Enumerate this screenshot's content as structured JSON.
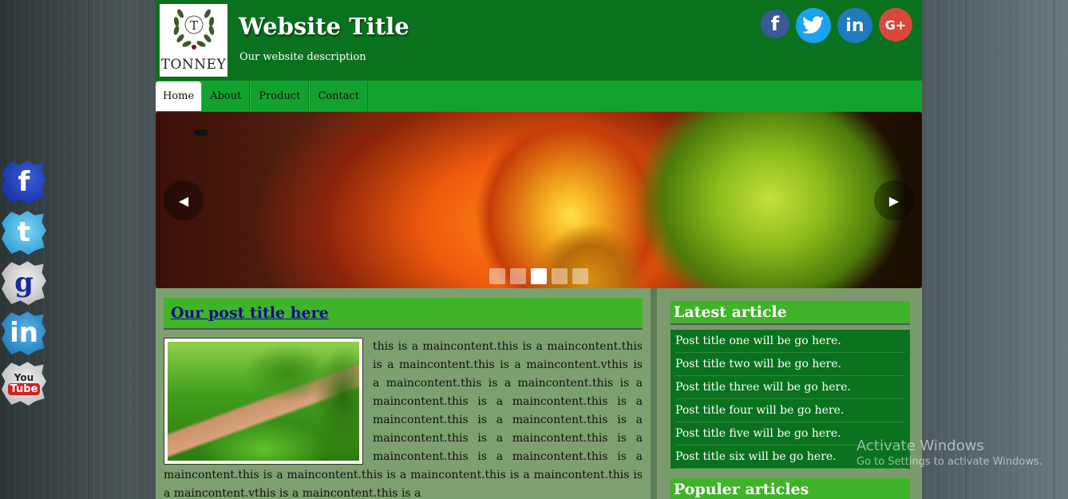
{
  "header": {
    "logo_letter": "T",
    "logo_name": "TONNEY",
    "title": "Website Title",
    "description": "Our website description",
    "social": [
      {
        "icon": "facebook-icon",
        "glyph": "f"
      },
      {
        "icon": "twitter-icon",
        "glyph": "🐦"
      },
      {
        "icon": "linkedin-icon",
        "glyph": "in"
      },
      {
        "icon": "google-plus-icon",
        "glyph": "G+"
      }
    ]
  },
  "nav": {
    "items": [
      "Home",
      "About",
      "Product",
      "Contact"
    ],
    "active": "Home"
  },
  "slider": {
    "prev_glyph": "◀",
    "next_glyph": "▶",
    "dot_count": 5,
    "active_dot": 3
  },
  "side_social": [
    {
      "icon": "facebook-icon",
      "glyph": "f"
    },
    {
      "icon": "twitter-icon",
      "glyph": "t"
    },
    {
      "icon": "google-icon",
      "glyph": "g"
    },
    {
      "icon": "linkedin-icon",
      "glyph": "in"
    },
    {
      "icon": "youtube-icon",
      "top": "You",
      "bottom": "Tube"
    }
  ],
  "post": {
    "title": "Our post title here",
    "text": "this is a maincontent.this is a maincontent.this is a maincontent.this is a maincontent.vthis is a maincontent.this is a maincontent.this is a maincontent.this is a maincontent.this is a maincontent.this is a maincontent.this is a maincontent.this is a maincontent.this is a maincontent.this is a maincontent.this is a maincontent.this is a maincontent.this is a maincontent.this is a maincontent.this is a maincontent.vthis is a maincontent.this is a"
  },
  "sidebar": {
    "latest_title": "Latest article",
    "latest_items": [
      "Post title one will be go here.",
      "Post title two will be go here.",
      "Post title three will be go here.",
      "Post title four will be go here.",
      "Post title five will be go here.",
      "Post title six will be go here."
    ],
    "popular_title": "Populer articles"
  },
  "watermark": {
    "title": "Activate Windows",
    "subtitle": "Go to Settings to activate Windows."
  }
}
